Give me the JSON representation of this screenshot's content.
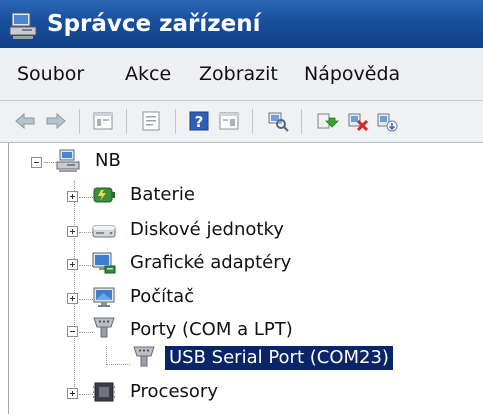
{
  "window": {
    "title": "Správce zařízení"
  },
  "menu": [
    "Soubor",
    "Akce",
    "Zobrazit",
    "Nápověda"
  ],
  "toolbar": {
    "buttons": [
      "back-icon",
      "forward-icon",
      "show-hide-tree-icon",
      "properties-icon",
      "help-icon",
      "view-icon",
      "scan-hardware-icon",
      "update-driver-icon",
      "uninstall-icon",
      "disable-device-icon"
    ]
  },
  "tree": {
    "root": "NB",
    "items": [
      "Baterie",
      "Diskové jednotky",
      "Grafické adaptéry",
      "Počítač",
      "Porty (COM a LPT)",
      "USB Serial Port (COM23)",
      "Procesory"
    ]
  },
  "colors": {
    "titlebar": "#184f9c",
    "selection": "#0a246a"
  }
}
